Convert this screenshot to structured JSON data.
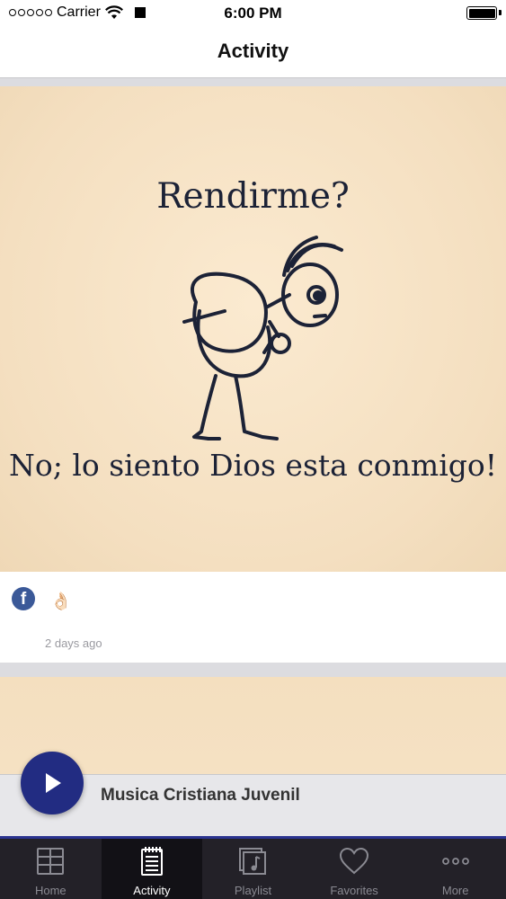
{
  "status_bar": {
    "carrier": "Carrier",
    "time": "6:00 PM"
  },
  "nav": {
    "title": "Activity"
  },
  "feed": {
    "posts": [
      {
        "image_title": "Rendirme?",
        "image_caption": "No; lo siento Dios esta conmigo!",
        "source_icon": "facebook-icon",
        "text": "👌🏻",
        "time": "2 days ago"
      }
    ]
  },
  "player": {
    "track_title": "Musica Cristiana Juvenil",
    "play_icon": "play-icon"
  },
  "tabs": [
    {
      "label": "Home",
      "icon": "grid-icon",
      "active": false
    },
    {
      "label": "Activity",
      "icon": "notepad-icon",
      "active": true
    },
    {
      "label": "Playlist",
      "icon": "music-note-icon",
      "active": false
    },
    {
      "label": "Favorites",
      "icon": "heart-icon",
      "active": false
    },
    {
      "label": "More",
      "icon": "more-dots-icon",
      "active": false
    }
  ],
  "colors": {
    "accent": "#222c82",
    "tab_bar": "#232128",
    "image_background": "#f7e4c7",
    "facebook": "#3b5998"
  }
}
